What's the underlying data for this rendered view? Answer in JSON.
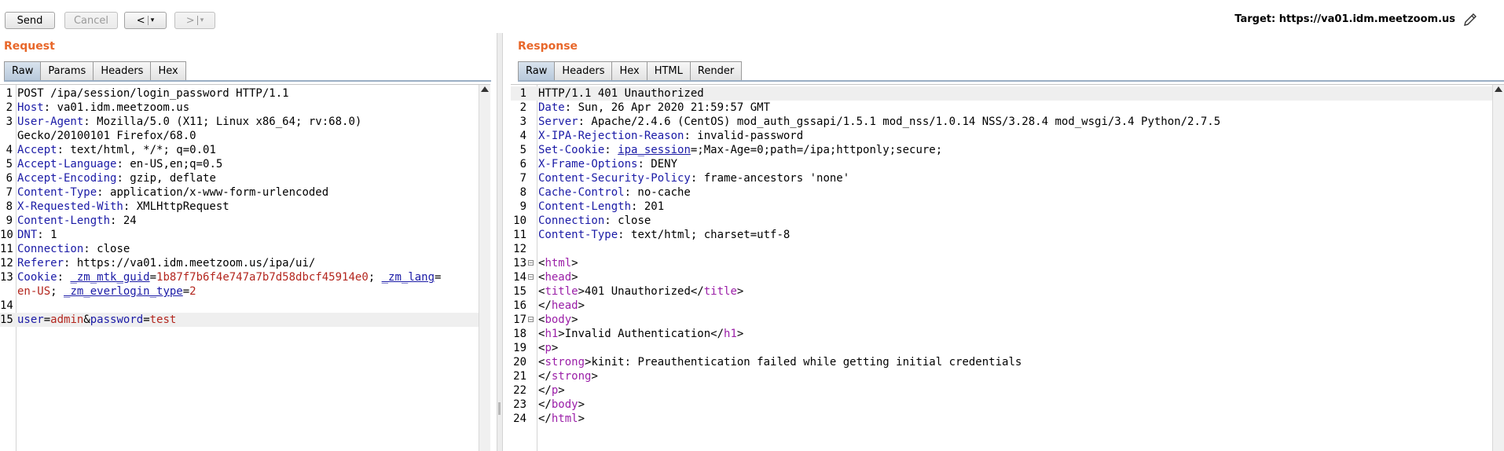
{
  "toolbar": {
    "send_label": "Send",
    "cancel_label": "Cancel",
    "back_label": "<",
    "forward_label": ">",
    "dropdown_glyph": "▾",
    "target_label": "Target:",
    "target_value": "https://va01.idm.meetzoom.us",
    "edit_icon": "pencil-icon"
  },
  "request": {
    "title": "Request",
    "tabs": [
      "Raw",
      "Params",
      "Headers",
      "Hex"
    ],
    "active_tab": "Raw",
    "lines": [
      {
        "n": "1",
        "parts": [
          {
            "t": "POST /ipa/session/login_password HTTP/1.1",
            "c": ""
          }
        ]
      },
      {
        "n": "2",
        "parts": [
          {
            "t": "Host",
            "c": "hn"
          },
          {
            "t": ": va01.idm.meetzoom.us",
            "c": ""
          }
        ]
      },
      {
        "n": "3",
        "parts": [
          {
            "t": "User-Agent",
            "c": "hn"
          },
          {
            "t": ": Mozilla/5.0 (X11; Linux x86_64; rv:68.0)",
            "c": ""
          }
        ]
      },
      {
        "n": "",
        "parts": [
          {
            "t": "Gecko/20100101 Firefox/68.0",
            "c": ""
          }
        ]
      },
      {
        "n": "4",
        "parts": [
          {
            "t": "Accept",
            "c": "hn"
          },
          {
            "t": ": text/html, */*; q=0.01",
            "c": ""
          }
        ]
      },
      {
        "n": "5",
        "parts": [
          {
            "t": "Accept-Language",
            "c": "hn"
          },
          {
            "t": ": en-US,en;q=0.5",
            "c": ""
          }
        ]
      },
      {
        "n": "6",
        "parts": [
          {
            "t": "Accept-Encoding",
            "c": "hn"
          },
          {
            "t": ": gzip, deflate",
            "c": ""
          }
        ]
      },
      {
        "n": "7",
        "parts": [
          {
            "t": "Content-Type",
            "c": "hn"
          },
          {
            "t": ": application/x-www-form-urlencoded",
            "c": ""
          }
        ]
      },
      {
        "n": "8",
        "parts": [
          {
            "t": "X-Requested-With",
            "c": "hn"
          },
          {
            "t": ": XMLHttpRequest",
            "c": ""
          }
        ]
      },
      {
        "n": "9",
        "parts": [
          {
            "t": "Content-Length",
            "c": "hn"
          },
          {
            "t": ": 24",
            "c": ""
          }
        ]
      },
      {
        "n": "10",
        "parts": [
          {
            "t": "DNT",
            "c": "hn"
          },
          {
            "t": ": 1",
            "c": ""
          }
        ]
      },
      {
        "n": "11",
        "parts": [
          {
            "t": "Connection",
            "c": "hn"
          },
          {
            "t": ": close",
            "c": ""
          }
        ]
      },
      {
        "n": "12",
        "parts": [
          {
            "t": "Referer",
            "c": "hn"
          },
          {
            "t": ": https://va01.idm.meetzoom.us/ipa/ui/",
            "c": ""
          }
        ]
      },
      {
        "n": "13",
        "parts": [
          {
            "t": "Cookie",
            "c": "hn"
          },
          {
            "t": ": ",
            "c": ""
          },
          {
            "t": "_zm_mtk_guid",
            "c": "ck"
          },
          {
            "t": "=",
            "c": ""
          },
          {
            "t": "1b87f7b6f4e747a7b7d58dbcf45914e0",
            "c": "cv"
          },
          {
            "t": "; ",
            "c": ""
          },
          {
            "t": "_zm_lang",
            "c": "ck"
          },
          {
            "t": "=",
            "c": ""
          }
        ]
      },
      {
        "n": "",
        "parts": [
          {
            "t": "en-US",
            "c": "cv"
          },
          {
            "t": "; ",
            "c": ""
          },
          {
            "t": "_zm_everlogin_type",
            "c": "ck"
          },
          {
            "t": "=",
            "c": ""
          },
          {
            "t": "2",
            "c": "cv"
          }
        ]
      },
      {
        "n": "14",
        "parts": []
      },
      {
        "n": "15",
        "hl": true,
        "parts": [
          {
            "t": "user",
            "c": "pn"
          },
          {
            "t": "=",
            "c": ""
          },
          {
            "t": "admin",
            "c": "pv"
          },
          {
            "t": "&",
            "c": ""
          },
          {
            "t": "password",
            "c": "pn"
          },
          {
            "t": "=",
            "c": ""
          },
          {
            "t": "test",
            "c": "pv"
          }
        ]
      }
    ]
  },
  "response": {
    "title": "Response",
    "tabs": [
      "Raw",
      "Headers",
      "Hex",
      "HTML",
      "Render"
    ],
    "active_tab": "Raw",
    "lines": [
      {
        "n": "1",
        "hl": true,
        "parts": [
          {
            "t": "HTTP/1.1 401 Unauthorized",
            "c": ""
          }
        ]
      },
      {
        "n": "2",
        "parts": [
          {
            "t": "Date",
            "c": "hn"
          },
          {
            "t": ": Sun, 26 Apr 2020 21:59:57 GMT",
            "c": ""
          }
        ]
      },
      {
        "n": "3",
        "parts": [
          {
            "t": "Server",
            "c": "hn"
          },
          {
            "t": ": Apache/2.4.6 (CentOS) mod_auth_gssapi/1.5.1 mod_nss/1.0.14 NSS/3.28.4 mod_wsgi/3.4 Python/2.7.5",
            "c": ""
          }
        ]
      },
      {
        "n": "4",
        "parts": [
          {
            "t": "X-IPA-Rejection-Reason",
            "c": "hn"
          },
          {
            "t": ": invalid-password",
            "c": ""
          }
        ]
      },
      {
        "n": "5",
        "parts": [
          {
            "t": "Set-Cookie",
            "c": "hn"
          },
          {
            "t": ": ",
            "c": ""
          },
          {
            "t": "ipa_session",
            "c": "ck"
          },
          {
            "t": "=;Max-Age=0;path=/ipa;httponly;secure;",
            "c": ""
          }
        ]
      },
      {
        "n": "6",
        "parts": [
          {
            "t": "X-Frame-Options",
            "c": "hn"
          },
          {
            "t": ": DENY",
            "c": ""
          }
        ]
      },
      {
        "n": "7",
        "parts": [
          {
            "t": "Content-Security-Policy",
            "c": "hn"
          },
          {
            "t": ": frame-ancestors 'none'",
            "c": ""
          }
        ]
      },
      {
        "n": "8",
        "parts": [
          {
            "t": "Cache-Control",
            "c": "hn"
          },
          {
            "t": ": no-cache",
            "c": ""
          }
        ]
      },
      {
        "n": "9",
        "parts": [
          {
            "t": "Content-Length",
            "c": "hn"
          },
          {
            "t": ": 201",
            "c": ""
          }
        ]
      },
      {
        "n": "10",
        "parts": [
          {
            "t": "Connection",
            "c": "hn"
          },
          {
            "t": ": close",
            "c": ""
          }
        ]
      },
      {
        "n": "11",
        "parts": [
          {
            "t": "Content-Type",
            "c": "hn"
          },
          {
            "t": ": text/html; charset=utf-8",
            "c": ""
          }
        ]
      },
      {
        "n": "12",
        "parts": []
      },
      {
        "n": "13",
        "fold": true,
        "parts": [
          {
            "t": "<",
            "c": ""
          },
          {
            "t": "html",
            "c": "tagn"
          },
          {
            "t": ">",
            "c": ""
          }
        ]
      },
      {
        "n": "14",
        "fold": true,
        "parts": [
          {
            "t": "<",
            "c": ""
          },
          {
            "t": "head",
            "c": "tagn"
          },
          {
            "t": ">",
            "c": ""
          }
        ]
      },
      {
        "n": "15",
        "parts": [
          {
            "t": "<",
            "c": ""
          },
          {
            "t": "title",
            "c": "tagn"
          },
          {
            "t": ">401 Unauthorized</",
            "c": ""
          },
          {
            "t": "title",
            "c": "tagn"
          },
          {
            "t": ">",
            "c": ""
          }
        ]
      },
      {
        "n": "16",
        "parts": [
          {
            "t": "</",
            "c": ""
          },
          {
            "t": "head",
            "c": "tagn"
          },
          {
            "t": ">",
            "c": ""
          }
        ]
      },
      {
        "n": "17",
        "fold": true,
        "parts": [
          {
            "t": "<",
            "c": ""
          },
          {
            "t": "body",
            "c": "tagn"
          },
          {
            "t": ">",
            "c": ""
          }
        ]
      },
      {
        "n": "18",
        "parts": [
          {
            "t": "<",
            "c": ""
          },
          {
            "t": "h1",
            "c": "tagn"
          },
          {
            "t": ">Invalid Authentication</",
            "c": ""
          },
          {
            "t": "h1",
            "c": "tagn"
          },
          {
            "t": ">",
            "c": ""
          }
        ]
      },
      {
        "n": "19",
        "parts": [
          {
            "t": "<",
            "c": ""
          },
          {
            "t": "p",
            "c": "tagn"
          },
          {
            "t": ">",
            "c": ""
          }
        ]
      },
      {
        "n": "20",
        "parts": [
          {
            "t": "<",
            "c": ""
          },
          {
            "t": "strong",
            "c": "tagn"
          },
          {
            "t": ">kinit: Preauthentication failed while getting initial credentials",
            "c": ""
          }
        ]
      },
      {
        "n": "21",
        "parts": [
          {
            "t": "</",
            "c": ""
          },
          {
            "t": "strong",
            "c": "tagn"
          },
          {
            "t": ">",
            "c": ""
          }
        ]
      },
      {
        "n": "22",
        "parts": [
          {
            "t": "</",
            "c": ""
          },
          {
            "t": "p",
            "c": "tagn"
          },
          {
            "t": ">",
            "c": ""
          }
        ]
      },
      {
        "n": "23",
        "parts": [
          {
            "t": "</",
            "c": ""
          },
          {
            "t": "body",
            "c": "tagn"
          },
          {
            "t": ">",
            "c": ""
          }
        ]
      },
      {
        "n": "24",
        "parts": [
          {
            "t": "</",
            "c": ""
          },
          {
            "t": "html",
            "c": "tagn"
          },
          {
            "t": ">",
            "c": ""
          }
        ]
      }
    ]
  }
}
